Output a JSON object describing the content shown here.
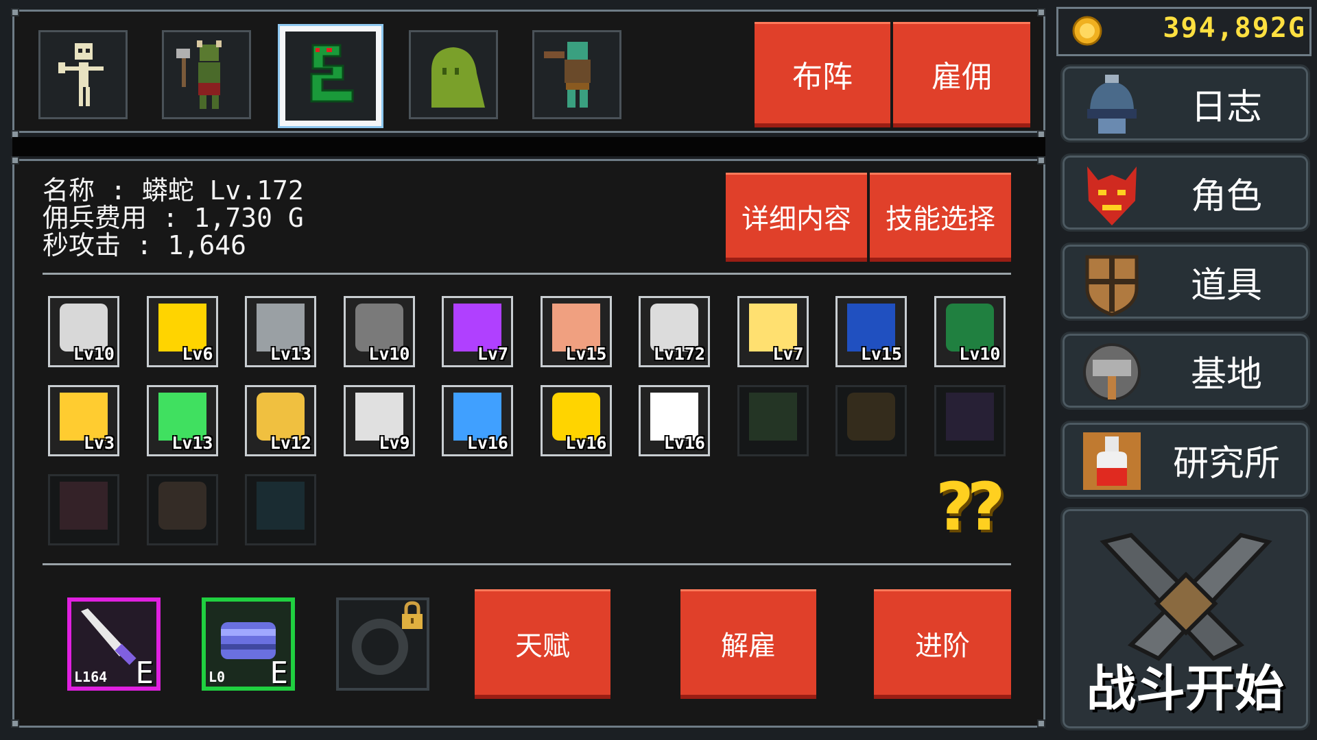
{
  "gold": {
    "value": "394,892G",
    "icon": "gold-coin-icon"
  },
  "top_bar": {
    "units": [
      {
        "name": "skeleton",
        "selected": false
      },
      {
        "name": "goblin-axe",
        "selected": false
      },
      {
        "name": "snake",
        "selected": true
      },
      {
        "name": "slime",
        "selected": false
      },
      {
        "name": "orc",
        "selected": false
      }
    ],
    "formation_label": "布阵",
    "hire_label": "雇佣"
  },
  "unit_info": {
    "line1": "名称 : 蟒蛇 Lv.172",
    "line2": "佣兵费用 : 1,730 G",
    "line3": "秒攻击 : 1,646",
    "details_label": "详细内容",
    "skill_label": "技能选择"
  },
  "items": [
    {
      "name": "shield",
      "level": "Lv10",
      "active": true,
      "color": "#d8d8d8"
    },
    {
      "name": "arrow-up",
      "level": "Lv6",
      "active": true,
      "color": "#ffd400"
    },
    {
      "name": "hammer",
      "level": "Lv13",
      "active": true,
      "color": "#9aa0a4"
    },
    {
      "name": "reaper",
      "level": "Lv10",
      "active": true,
      "color": "#7a7a7a"
    },
    {
      "name": "purple-burst",
      "level": "Lv7",
      "active": true,
      "color": "#b040ff"
    },
    {
      "name": "money-bag",
      "level": "Lv15",
      "active": true,
      "color": "#f0a080"
    },
    {
      "name": "sword",
      "level": "Lv172",
      "active": true,
      "color": "#dcdcdc"
    },
    {
      "name": "stars",
      "level": "Lv7",
      "active": true,
      "color": "#ffe070"
    },
    {
      "name": "blue-arrows",
      "level": "Lv15",
      "active": true,
      "color": "#2050c0"
    },
    {
      "name": "green-arrows",
      "level": "Lv10",
      "active": true,
      "color": "#208040"
    },
    {
      "name": "potion-flask",
      "level": "Lv3",
      "active": true,
      "color": "#ffcc30"
    },
    {
      "name": "green-dagger",
      "level": "Lv13",
      "active": true,
      "color": "#40e060"
    },
    {
      "name": "golden-blade",
      "level": "Lv12",
      "active": true,
      "color": "#f0c040"
    },
    {
      "name": "shield-clock",
      "level": "Lv9",
      "active": true,
      "color": "#e0e0e0"
    },
    {
      "name": "blue-lightning",
      "level": "Lv16",
      "active": true,
      "color": "#40a0ff"
    },
    {
      "name": "yellow-up",
      "level": "Lv16",
      "active": true,
      "color": "#ffd400"
    },
    {
      "name": "ring-arc",
      "level": "Lv16",
      "active": true,
      "color": "#ffffff"
    },
    {
      "name": "locked-green",
      "level": "",
      "active": false,
      "color": "#2e4a2e"
    },
    {
      "name": "locked-brown",
      "level": "",
      "active": false,
      "color": "#4a3a20"
    },
    {
      "name": "locked-drop",
      "level": "",
      "active": false,
      "color": "#34264a"
    },
    {
      "name": "locked-cross",
      "level": "",
      "active": false,
      "color": "#4a2a34"
    },
    {
      "name": "locked-eye",
      "level": "",
      "active": false,
      "color": "#4a3a30"
    },
    {
      "name": "locked-wing",
      "level": "",
      "active": false,
      "color": "#1e3a44"
    }
  ],
  "mystery": "??",
  "equipment": [
    {
      "name": "purple-knife",
      "level": "L164",
      "tag": "E",
      "border": "#e020e0"
    },
    {
      "name": "blue-bracelet",
      "level": "L0",
      "tag": "E",
      "border": "#20d040"
    },
    {
      "name": "locked-ring",
      "level": "",
      "tag": "",
      "border": "#4a5258"
    }
  ],
  "actions": {
    "talent": "天赋",
    "dismiss": "解雇",
    "advance": "进阶"
  },
  "menu": [
    {
      "label": "日志",
      "icon": "journal-helmet-icon"
    },
    {
      "label": "角色",
      "icon": "demon-mask-icon"
    },
    {
      "label": "道具",
      "icon": "wooden-shield-icon"
    },
    {
      "label": "基地",
      "icon": "hammer-base-icon"
    },
    {
      "label": "研究所",
      "icon": "potion-lab-icon"
    }
  ],
  "battle_start": "战斗开始"
}
